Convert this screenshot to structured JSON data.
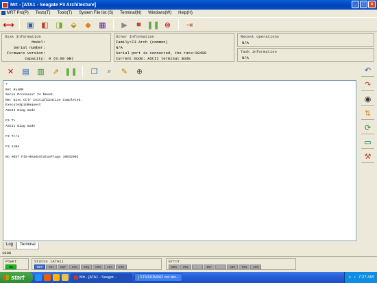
{
  "window": {
    "title": "Mrt - [ATA1 - Seagate F3 Architecture]"
  },
  "menu": [
    {
      "label": "MRT Pro(P)"
    },
    {
      "label": "Tests(T)"
    },
    {
      "label": "Tools(T)"
    },
    {
      "label": "System File list (S)"
    },
    {
      "label": "Terminal(N)"
    },
    {
      "label": "Windows(W)"
    },
    {
      "label": "Help(H)"
    }
  ],
  "disk_info": {
    "title": "Disk Information",
    "model_label": "Model:",
    "serial_label": "Serial number:",
    "firmware_label": "Firmware version:",
    "capacity_label": "Capacity:",
    "capacity_value": "0 (0.00 GB)"
  },
  "other_info": {
    "title": "Other Information",
    "family": "Family:F3 Arch (common)",
    "na": "N/A",
    "serial_port": "Serial port is connected, the rate:38400",
    "mode": "Current mode: ASCII terminal mode"
  },
  "recent_ops": {
    "title": "Recent operations",
    "value": "N/A"
  },
  "task_info": {
    "title": "Task information",
    "value": "N/A"
  },
  "terminal": {
    "lines": [
      "?",
      "Rst 0x40M",
      "Servo Processor Is Reset.",
      "RW: Disc Ctlr Initialization Completed.",
      "ExecuteSpinRequest",
      "ASCII Diag mode",
      "",
      "F3 T>",
      "ASCII Diag mode",
      "",
      "F3 T>/1",
      "",
      "F3 1>NA",
      "",
      "No HOST FIS-ReadyStatusFlags 10032002"
    ]
  },
  "tabs": [
    {
      "label": "Log"
    },
    {
      "label": "Terminal"
    }
  ],
  "status_number": "1000",
  "power": {
    "title": "Power",
    "indicator": "ON"
  },
  "status_ata": {
    "title": "Status (ATA1)",
    "flags": [
      "BSY",
      "RDY",
      "DWF",
      "DSC",
      "DRQ",
      "CRR",
      "IDX",
      "ERR"
    ]
  },
  "error": {
    "title": "Error",
    "flags": [
      "BBK",
      "UNC",
      "",
      "INF",
      "",
      "ABR",
      "T0N",
      "AMN"
    ]
  },
  "taskbar": {
    "start_label": "start",
    "tasks": [
      {
        "label": "Mrt - [ATA1 - Seagat..."
      },
      {
        "label": "ST500DM002 not det..."
      }
    ],
    "clock": "7:27 AM"
  },
  "colors": {
    "title_bar": "#0043b8",
    "power_on": "#17c217",
    "status_on": "#3b6ed8",
    "indicator_off": "#a9a9a9"
  }
}
